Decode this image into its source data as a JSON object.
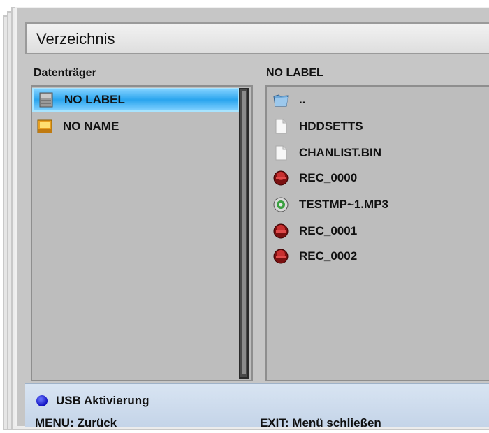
{
  "window": {
    "title": "Verzeichnis"
  },
  "left_panel": {
    "label": "Datenträger",
    "items": [
      {
        "label": "NO LABEL",
        "icon": "drive-icon",
        "selected": true
      },
      {
        "label": "NO NAME",
        "icon": "folder-drive-icon",
        "selected": false
      }
    ]
  },
  "right_panel": {
    "label": "NO LABEL",
    "items": [
      {
        "label": "..",
        "icon": "folder-up-icon"
      },
      {
        "label": "HDDSETTS",
        "icon": "file-icon"
      },
      {
        "label": "CHANLIST.BIN",
        "icon": "file-icon"
      },
      {
        "label": "REC_0000",
        "icon": "recording-icon"
      },
      {
        "label": "TESTMP~1.MP3",
        "icon": "audio-file-icon"
      },
      {
        "label": "REC_0001",
        "icon": "recording-icon"
      },
      {
        "label": "REC_0002",
        "icon": "recording-icon"
      }
    ]
  },
  "footer": {
    "usb_label": "USB Aktivierung",
    "menu_label": "MENU: Zurück",
    "exit_label": "EXIT: Menü schließen",
    "usb_color": "#1010c0"
  }
}
